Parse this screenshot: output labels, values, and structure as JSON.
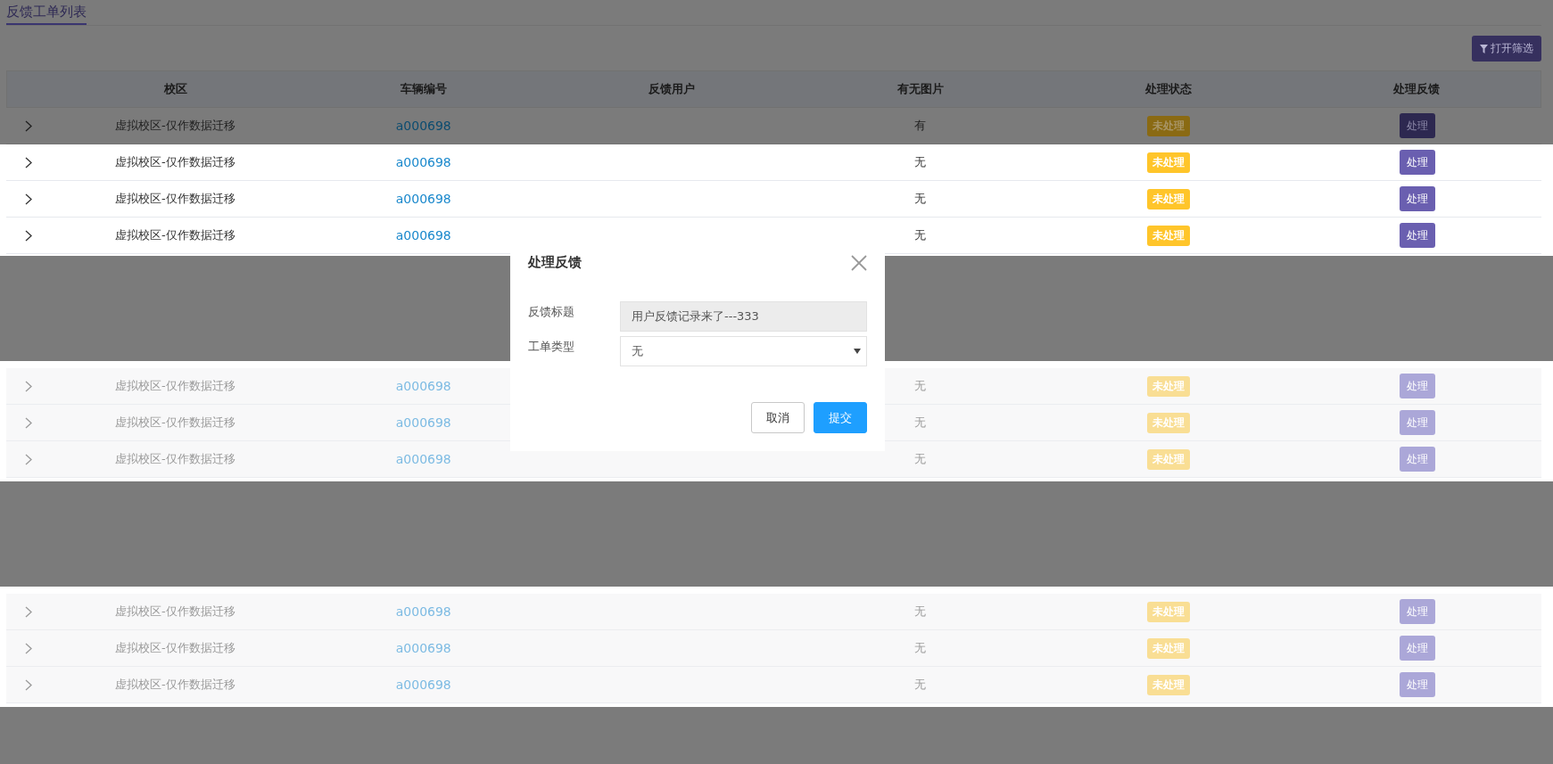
{
  "page_tab": {
    "label": "反馈工单列表",
    "selected": true
  },
  "filter_button": {
    "label": "打开筛选"
  },
  "table": {
    "columns": [
      "校区",
      "车辆编号",
      "反馈用户",
      "有无图片",
      "处理状态",
      "处理反馈"
    ],
    "row_groups": [
      {
        "kind": "overlaid",
        "rows": [
          {
            "campus": "虚拟校区-仅作数据迁移",
            "vehicle": "a000698",
            "has_image": "有",
            "status": "未处理",
            "action": "处理"
          }
        ]
      },
      {
        "kind": "plain",
        "rows": [
          {
            "campus": "虚拟校区-仅作数据迁移",
            "vehicle": "a000698",
            "has_image": "无",
            "status": "未处理",
            "action": "处理"
          },
          {
            "campus": "虚拟校区-仅作数据迁移",
            "vehicle": "a000698",
            "has_image": "无",
            "status": "未处理",
            "action": "处理"
          },
          {
            "campus": "虚拟校区-仅作数据迁移",
            "vehicle": "a000698",
            "has_image": "无",
            "status": "未处理",
            "action": "处理"
          }
        ]
      },
      {
        "kind": "faded",
        "rows": [
          {
            "campus": "虚拟校区-仅作数据迁移",
            "vehicle": "a000698",
            "has_image": "无",
            "status": "未处理",
            "action": "处理"
          },
          {
            "campus": "虚拟校区-仅作数据迁移",
            "vehicle": "a000698",
            "has_image": "无",
            "status": "未处理",
            "action": "处理"
          },
          {
            "campus": "虚拟校区-仅作数据迁移",
            "vehicle": "a000698",
            "has_image": "无",
            "status": "未处理",
            "action": "处理"
          }
        ]
      },
      {
        "kind": "faded",
        "rows": [
          {
            "campus": "虚拟校区-仅作数据迁移",
            "vehicle": "a000698",
            "has_image": "无",
            "status": "未处理",
            "action": "处理"
          },
          {
            "campus": "虚拟校区-仅作数据迁移",
            "vehicle": "a000698",
            "has_image": "无",
            "status": "未处理",
            "action": "处理"
          },
          {
            "campus": "虚拟校区-仅作数据迁移",
            "vehicle": "a000698",
            "has_image": "无",
            "status": "未处理",
            "action": "处理"
          }
        ]
      }
    ]
  },
  "dialog": {
    "title": "处理反馈",
    "fields": [
      {
        "kind": "text",
        "label": "反馈标题",
        "value": "用户反馈记录来了---333",
        "disabled": true
      },
      {
        "kind": "select",
        "label": "工单类型",
        "value": "无"
      }
    ],
    "buttons": [
      {
        "kind": "default",
        "label": "取消"
      },
      {
        "kind": "primary",
        "label": "提交"
      }
    ]
  }
}
